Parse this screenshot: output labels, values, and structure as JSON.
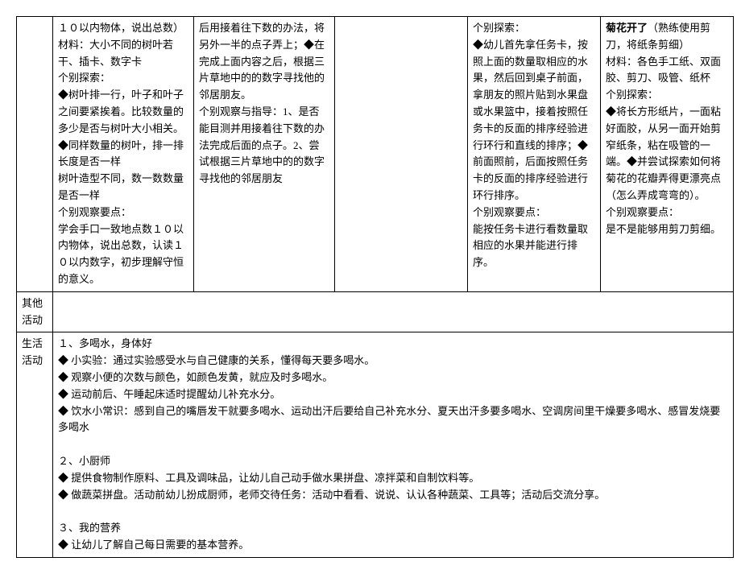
{
  "row1": {
    "col1": "１０以内物体，说出总数）\n材料：大小不同的树叶若干、插卡、数字卡\n个别探索：\n◆树叶排一行，叶子和叶子之间要紧挨着。比较数量的多少是否与树叶大小相关。\n◆同样数量的树叶，排一排长度是否一样\n树叶造型不同，数一数数量是否一样\n个别观察要点：\n学会手口一致地点数１０以内物体，说出总数，认读１０以内数字，初步理解守恒的意义。",
    "col2": "后用接着往下数的办法，将另外一半的点子弄上；◆在完成上面内容之后，根据三片草地中的的数字寻找他的邻居朋友。\n个别观察与指导：1、是否能目测并用接着往下数的办法完成后面的点子。2、尝试根据三片草地中的的数字寻找他的邻居朋友",
    "col3": "",
    "col4": "个别探索：\n◆幼儿首先拿任务卡，按照上面的数量取相应的水果，然后回到桌子前面，拿朋友的照片贴到水果盘或水果篮中，接着按照任务卡的反面的排序经验进行环行和直线的排序；◆前面照前，后面按照任务卡的反面的排序经验进行环行排序。\n个别观察要点：\n能按任务卡进行看数量取相应的水果并能进行排序。",
    "col5_title": "菊花开了",
    "col5_desc": "（熟练使用剪刀，将纸条剪细）",
    "col5_body": "材料：各色手工纸、双面胶、剪刀、吸管、纸杯\n个别探索：\n◆将长方形纸片，一面粘好面胶，从另一面开始剪窄纸条，粘在吸管的一端。◆并尝试探索如何将菊花的花瓣弄得更漂亮点（怎么弄成弯弯的）。\n个别观察要点：\n是不是能够用剪刀剪细。"
  },
  "labels": {
    "other_activities": "其他活动",
    "life_activities": "生活活动"
  },
  "life_activities": {
    "section1_title": "１、多喝水，身体好",
    "section1_b1": "◆ 小实验：通过实验感受水与自己健康的关系，懂得每天要多喝水。",
    "section1_b2": "◆ 观察小便的次数与颜色，如颜色发黄，就应及时多喝水。",
    "section1_b3": "◆ 运动前后、午睡起床适时提醒幼儿补充水分。",
    "section1_b4": "◆ 饮水小常识：感到自己的嘴唇发干就要多喝水、运动出汗后要给自己补充水分、夏天出汗多要多喝水、空调房间里干燥要多喝水、感冒发烧要多喝水",
    "section2_title": "２、小厨师",
    "section2_b1": "◆ 提供食物制作原料、工具及调味品，让幼儿自己动手做水果拼盘、凉拌菜和自制饮料等。",
    "section2_b2": "◆ 做蔬菜拼盘。活动前幼儿扮成厨师，老师交待任务：活动中看看、说说、认认各种蔬菜、工具等；活动后交流分享。",
    "section3_title": "３、我的营养",
    "section3_b1": "◆ 让幼儿了解自己每日需要的基本营养。"
  }
}
